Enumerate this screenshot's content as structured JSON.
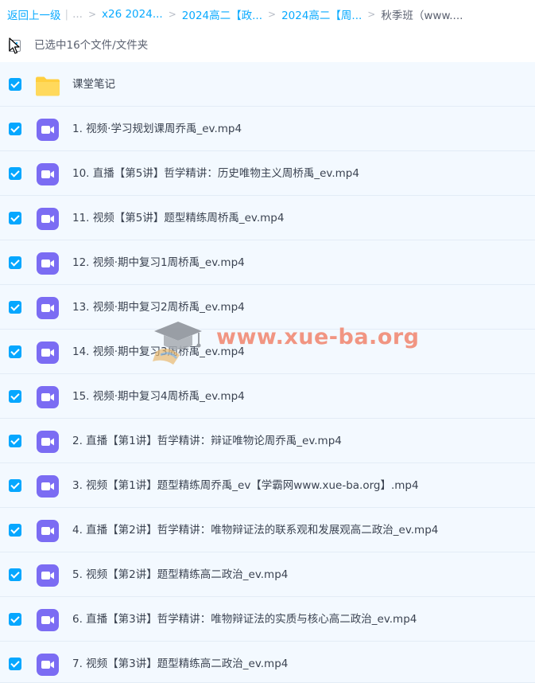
{
  "breadcrumb": {
    "back": "返回上一级",
    "ellipsis": "...",
    "crumbs": [
      "x26 2024...",
      "2024高二【政...",
      "2024高二【周..."
    ],
    "current": "秋季班（www...."
  },
  "selection": {
    "text": "已选中16个文件/文件夹"
  },
  "files": [
    {
      "name": "课堂笔记",
      "type": "folder",
      "checked": true
    },
    {
      "name": "1. 视频·学习规划课周乔禹_ev.mp4",
      "type": "video",
      "checked": true
    },
    {
      "name": "10. 直播【第5讲】哲学精讲：历史唯物主义周桥禹_ev.mp4",
      "type": "video",
      "checked": true
    },
    {
      "name": "11. 视频【第5讲】题型精练周桥禹_ev.mp4",
      "type": "video",
      "checked": true
    },
    {
      "name": "12. 视频·期中复习1周桥禹_ev.mp4",
      "type": "video",
      "checked": true
    },
    {
      "name": "13. 视频·期中复习2周桥禹_ev.mp4",
      "type": "video",
      "checked": true
    },
    {
      "name": "14. 视频·期中复习3周桥禹_ev.mp4",
      "type": "video",
      "checked": true
    },
    {
      "name": "15. 视频·期中复习4周桥禹_ev.mp4",
      "type": "video",
      "checked": true
    },
    {
      "name": "2. 直播【第1讲】哲学精讲：辩证唯物论周乔禹_ev.mp4",
      "type": "video",
      "checked": true
    },
    {
      "name": "3. 视频【第1讲】题型精练周乔禹_ev【学霸网www.xue-ba.org】.mp4",
      "type": "video",
      "checked": true
    },
    {
      "name": "4. 直播【第2讲】哲学精讲：唯物辩证法的联系观和发展观高二政治_ev.mp4",
      "type": "video",
      "checked": true
    },
    {
      "name": "5. 视频【第2讲】题型精练高二政治_ev.mp4",
      "type": "video",
      "checked": true
    },
    {
      "name": "6. 直播【第3讲】哲学精讲：唯物辩证法的实质与核心高二政治_ev.mp4",
      "type": "video",
      "checked": true
    },
    {
      "name": "7. 视频【第3讲】题型精练高二政治_ev.mp4",
      "type": "video",
      "checked": true
    }
  ],
  "watermark": {
    "text": "www.xue-ba.org"
  },
  "colors": {
    "accent": "#06a7ff",
    "video_icon": "#7b6cf3",
    "folder_icon": "#ffd24d",
    "row_bg": "#f3f9ff"
  }
}
